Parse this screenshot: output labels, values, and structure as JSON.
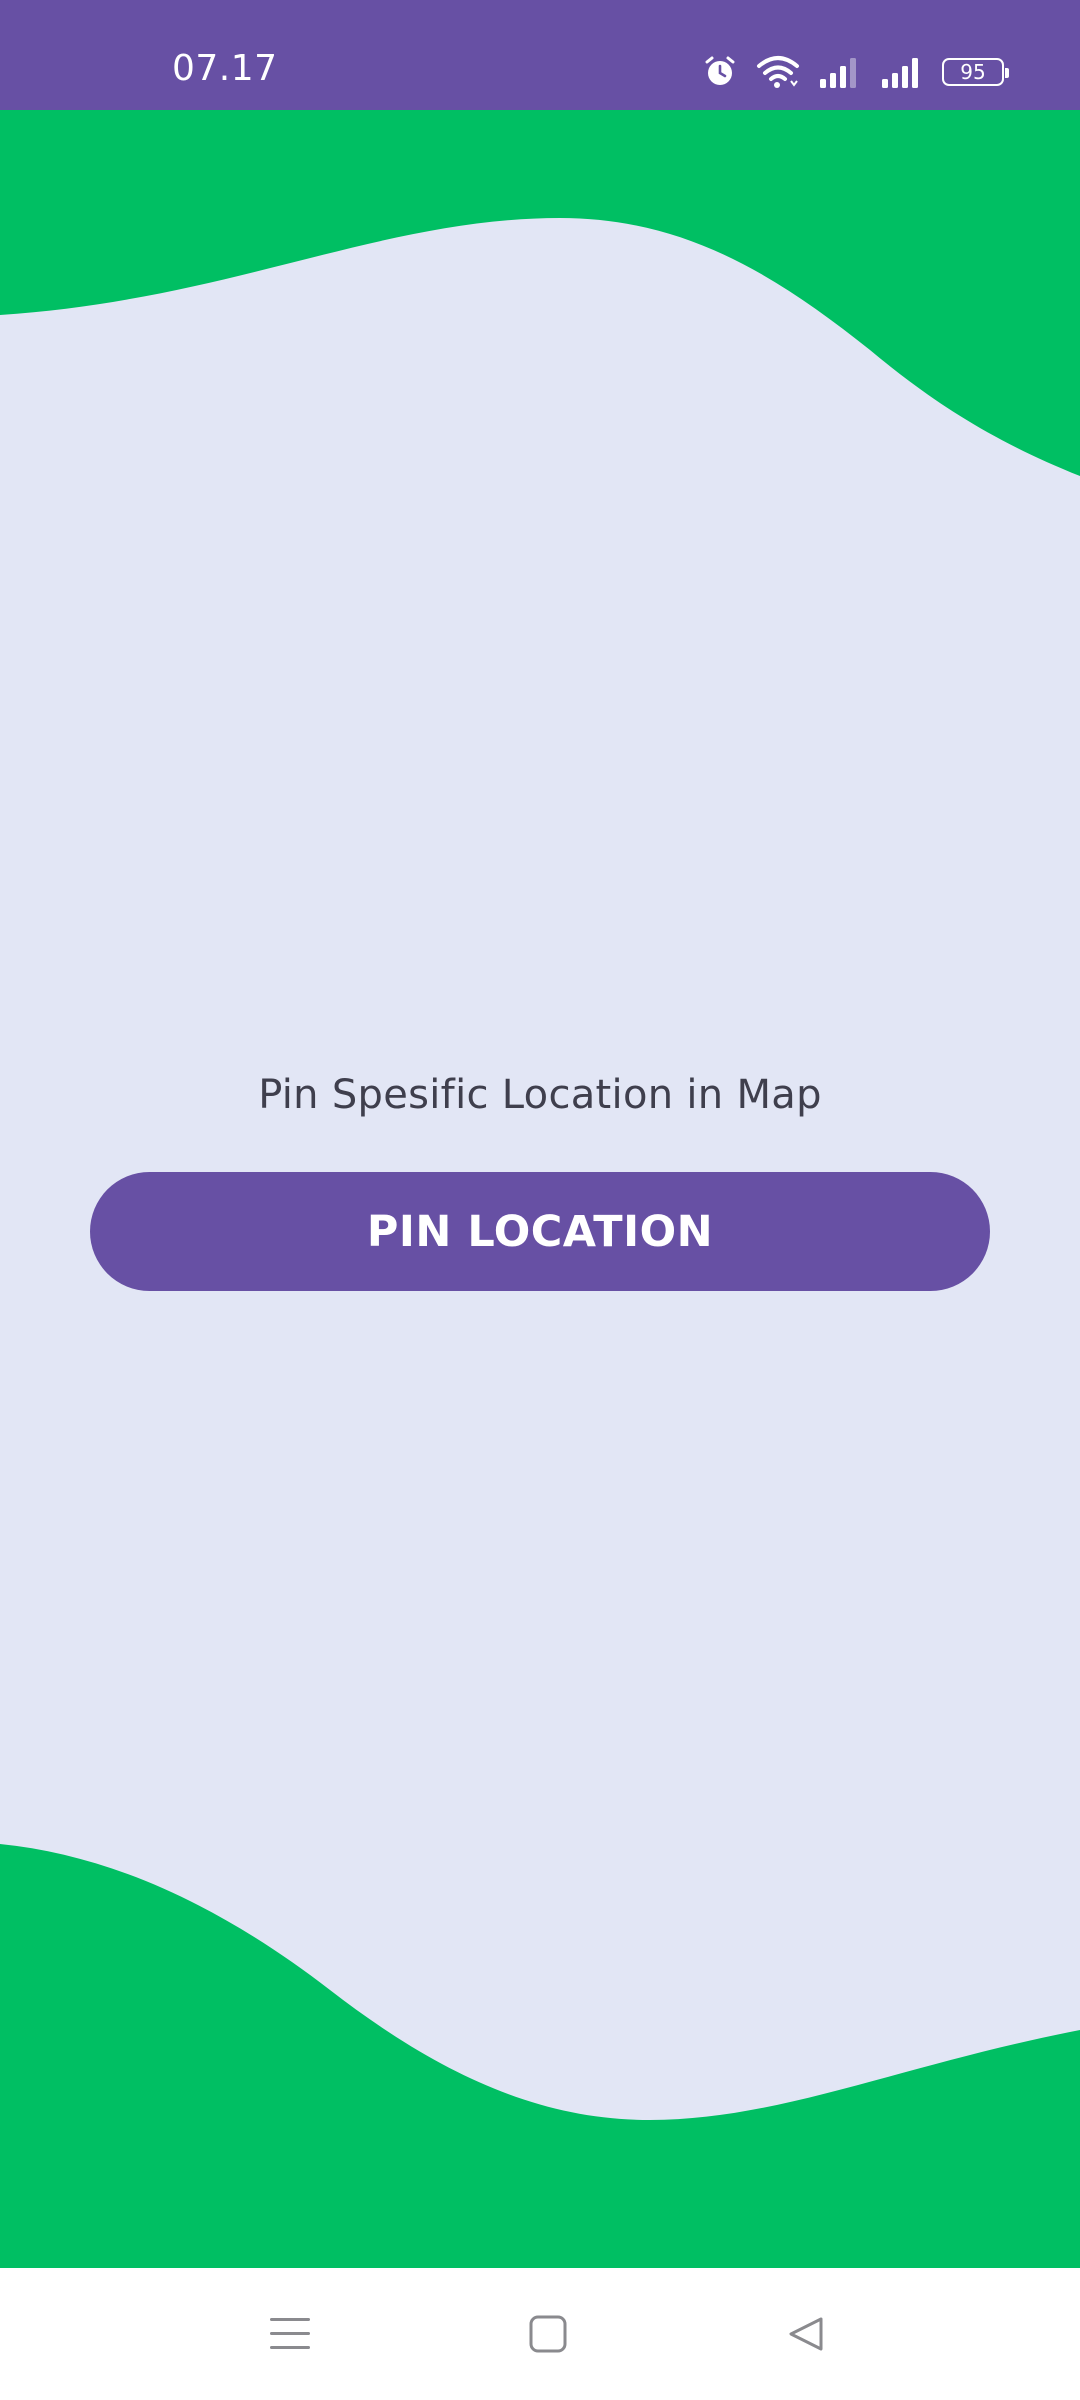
{
  "status_bar": {
    "time": "07.17",
    "battery_level": "95",
    "icons": [
      "alarm-icon",
      "wifi-icon",
      "signal-icon-sim1",
      "signal-icon-sim2",
      "battery-icon"
    ]
  },
  "main": {
    "prompt": "Pin Spesific Location in Map",
    "button_label": "PIN LOCATION"
  },
  "navigation_bar": {
    "buttons": [
      "menu-icon",
      "home-icon",
      "back-icon"
    ]
  },
  "colors": {
    "primary": "#6750a4",
    "wave_green": "#00bf63",
    "background": "#e2e6f5",
    "text": "#3f3f4d"
  }
}
